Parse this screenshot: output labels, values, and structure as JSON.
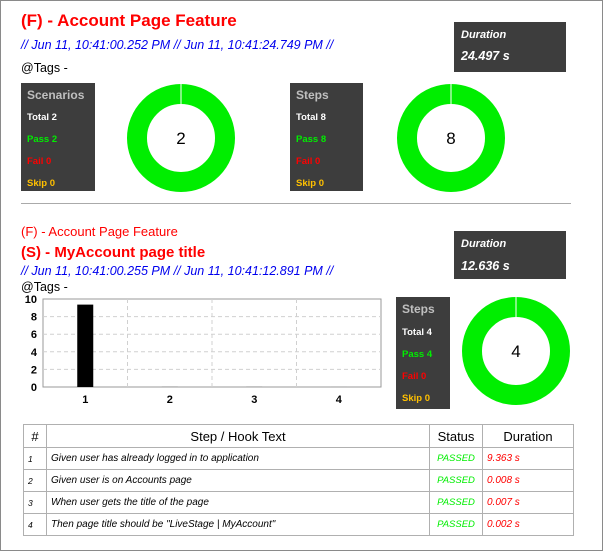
{
  "feature": {
    "title": "(F) - Account Page Feature",
    "times": "//  Jun 11, 10:41:00.252 PM  //  Jun 11, 10:41:24.749 PM  //",
    "tags": "@Tags -",
    "duration_label": "Duration",
    "duration_value": "24.497 s",
    "scenarios": {
      "header": "Scenarios",
      "total": "Total 2",
      "pass": "Pass 2",
      "fail": "Fail 0",
      "skip": "Skip 0",
      "donut_value": "2",
      "pass_fraction": 1
    },
    "steps": {
      "header": "Steps",
      "total": "Total 8",
      "pass": "Pass 8",
      "fail": "Fail 0",
      "skip": "Skip 0",
      "donut_value": "8",
      "pass_fraction": 1
    }
  },
  "scenario": {
    "feature_label": "(F) - Account Page Feature",
    "title": "(S) - MyAccount page title",
    "times": "//  Jun 11, 10:41:00.255 PM  //  Jun 11, 10:41:12.891 PM  //",
    "tags": "@Tags -",
    "duration_label": "Duration",
    "duration_value": "12.636 s",
    "steps": {
      "header": "Steps",
      "total": "Total 4",
      "pass": "Pass 4",
      "fail": "Fail 0",
      "skip": "Skip 0",
      "donut_value": "4",
      "pass_fraction": 1
    },
    "table": {
      "headers": [
        "#",
        "Step / Hook Text",
        "Status",
        "Duration"
      ],
      "rows": [
        {
          "num": "1",
          "text": "Given user has already logged in to application",
          "status": "PASSED",
          "duration": "9.363 s"
        },
        {
          "num": "2",
          "text": "Given user is on Accounts page",
          "status": "PASSED",
          "duration": "0.008 s"
        },
        {
          "num": "3",
          "text": "When user gets the title of the page",
          "status": "PASSED",
          "duration": "0.007 s"
        },
        {
          "num": "4",
          "text": "Then page title should  be \"LiveStage | MyAccount\"",
          "status": "PASSED",
          "duration": "0.002 s"
        }
      ]
    }
  },
  "chart_data": {
    "type": "bar",
    "categories": [
      "1",
      "2",
      "3",
      "4"
    ],
    "values": [
      9.363,
      0.008,
      0.007,
      0.002
    ],
    "ylim": [
      0,
      10
    ],
    "yticks": [
      "0",
      "2",
      "4",
      "6",
      "8",
      "10"
    ],
    "bar_color": "#000000",
    "grid": true
  },
  "colors": {
    "pass": "#00ee00",
    "fail": "#ff0000",
    "skip": "#ffc000",
    "panel": "#3d3d3d",
    "title": "#ff0000",
    "time": "#0000ee"
  }
}
